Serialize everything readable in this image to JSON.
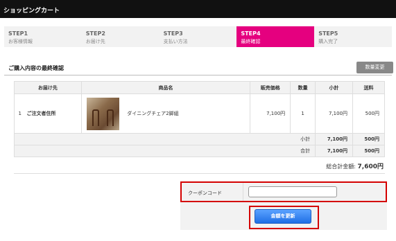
{
  "page_title": "ショッピングカート",
  "steps": [
    {
      "label": "STEP1",
      "sub": "お客様情報",
      "active": false
    },
    {
      "label": "STEP2",
      "sub": "お届け先",
      "active": false
    },
    {
      "label": "STEP3",
      "sub": "支払い方法",
      "active": false
    },
    {
      "label": "STEP4",
      "sub": "最終確認",
      "active": true
    },
    {
      "label": "STEP5",
      "sub": "購入完了",
      "active": false
    }
  ],
  "section_title": "ご購入内容の最終確認",
  "qty_change_label": "数量変更",
  "table": {
    "headers": [
      "お届け先",
      "商品名",
      "販売価格",
      "数量",
      "小計",
      "送料"
    ],
    "row": {
      "index": "1",
      "destination": "ご注文者住所",
      "product": "ダイニングチェア2脚組",
      "price": "7,100円",
      "qty": "1",
      "subtotal": "7,100円",
      "shipping": "500円"
    },
    "subtotal_row": {
      "label": "小計",
      "amount": "7,100円",
      "shipping": "500円"
    },
    "total_row": {
      "label": "合計",
      "amount": "7,100円",
      "shipping": "500円"
    }
  },
  "grand_total": {
    "label": "総合計金額:",
    "value": "7,600円"
  },
  "coupon": {
    "label": "クーポンコード",
    "value": "",
    "placeholder": ""
  },
  "update_button_label": "金額を更新",
  "colors": {
    "active_step": "#e5007f",
    "highlight": "#d40000",
    "button": "#1f6fe5"
  }
}
